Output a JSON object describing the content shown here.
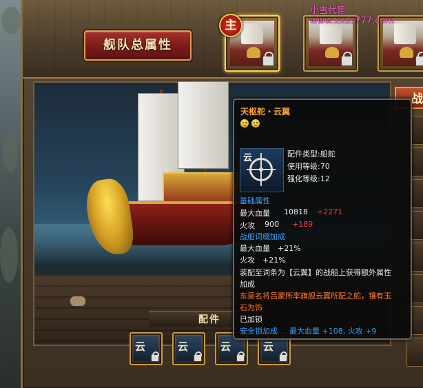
{
  "watermark": "小雪代售www.xxds777.com",
  "header": {
    "fleet_button_label": "舰队总属性",
    "main_badge": "主"
  },
  "ship_slots": [
    {
      "name": "ship-1",
      "selected": true,
      "locked": true
    },
    {
      "name": "ship-2",
      "selected": false,
      "locked": true
    },
    {
      "name": "ship-3",
      "selected": false,
      "locked": true
    }
  ],
  "side_tab_label": "战",
  "parts_label": "配件",
  "part_slots": [
    {
      "glyph": "云",
      "locked": true
    },
    {
      "glyph": "云",
      "locked": true
    },
    {
      "glyph": "云",
      "locked": true
    },
    {
      "glyph": "云",
      "locked": true
    }
  ],
  "tooltip": {
    "name": "天枢舵・云翼",
    "part_type": "配件类型:船舵",
    "use_level": "使用等级:70",
    "enhance_level": "强化等级:12",
    "icon_glyph": "云",
    "base_attr_title": "基础属性",
    "hp_label": "最大血量",
    "hp_value": "10818",
    "hp_bonus": "+2271",
    "fire_label": "火攻",
    "fire_value": "900",
    "fire_bonus": "+189",
    "affix_title": "战船词缀加成",
    "affix_hp": "最大血量　+21%",
    "affix_fire": "火攻　+21%",
    "equip_desc_line1": "装配至词条为【云翼】的战船上获得额外属性",
    "equip_desc_line2": "加成",
    "flavor_line1": "东吴名将吕蒙所率旗舰云翼所配之舵，镶有玉",
    "flavor_line2": "石为饰",
    "locked_text": "已加锁",
    "lock_bonus_title": "安全锁加成",
    "lock_bonus_value": "最大血量 +108, 火攻 +9"
  },
  "colors": {
    "item_name": "#f2a531",
    "section_blue": "#3aa0ff",
    "bonus_red": "#ff3a3a",
    "flavor_orange": "#ff7a2a",
    "watermark_pink": "#ff5ad2"
  }
}
